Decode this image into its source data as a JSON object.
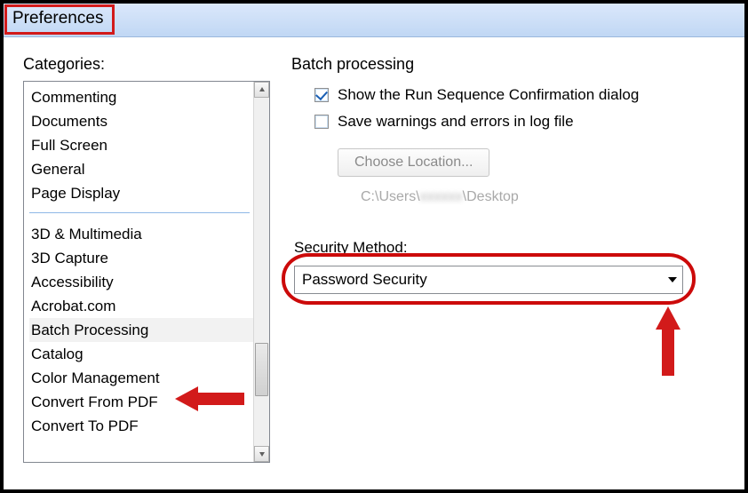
{
  "window": {
    "title": "Preferences"
  },
  "sidebar": {
    "label": "Categories:",
    "group1": [
      "Commenting",
      "Documents",
      "Full Screen",
      "General",
      "Page Display"
    ],
    "group2": [
      "3D & Multimedia",
      "3D Capture",
      "Accessibility",
      "Acrobat.com",
      "Batch Processing",
      "Catalog",
      "Color Management",
      "Convert From PDF",
      "Convert To PDF"
    ],
    "selected": "Batch Processing"
  },
  "panel": {
    "heading": "Batch processing",
    "opt_show_confirm": "Show the Run Sequence Confirmation dialog",
    "opt_show_confirm_checked": true,
    "opt_save_log": "Save warnings and errors in log file",
    "opt_save_log_checked": false,
    "choose_location_label": "Choose Location...",
    "path_prefix": "C:\\Users\\",
    "path_user_obscured": "xxxxxx",
    "path_suffix": "\\Desktop",
    "security_method_label": "Security Method:",
    "security_method_value": "Password Security"
  }
}
